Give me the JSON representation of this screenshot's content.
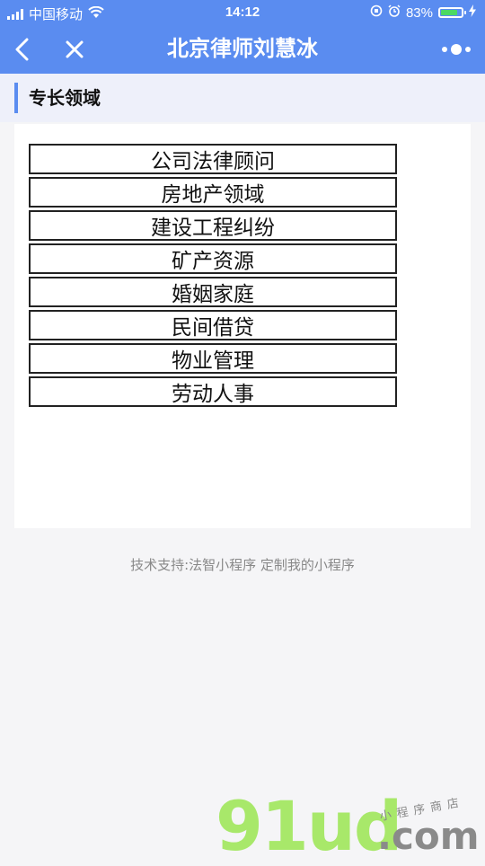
{
  "status_bar": {
    "carrier": "中国移动",
    "time": "14:12",
    "battery_percent": "83%",
    "battery_level": 0.83,
    "icons": [
      "signal-icon",
      "wifi-icon",
      "orientation-lock-icon",
      "alarm-icon",
      "battery-icon",
      "charging-icon"
    ]
  },
  "nav": {
    "title": "北京律师刘慧冰",
    "back_icon": "chevron-left-icon",
    "close_icon": "close-icon",
    "more_icon": "more-dots-icon"
  },
  "section": {
    "title": "专长领域",
    "accent_color": "#5a8cf0"
  },
  "specialties": [
    "公司法律顾问",
    "房地产领域",
    "建设工程纠纷",
    "矿产资源",
    "婚姻家庭",
    "民间借贷",
    "物业管理",
    "劳动人事"
  ],
  "footer": {
    "text": "技术支持:法智小程序 定制我的小程序"
  },
  "watermark": {
    "logo": "91ud",
    "domain": ".com",
    "tagline": "小程序商店"
  },
  "colors": {
    "primary": "#5a8cf0",
    "background": "#f5f5f7"
  }
}
